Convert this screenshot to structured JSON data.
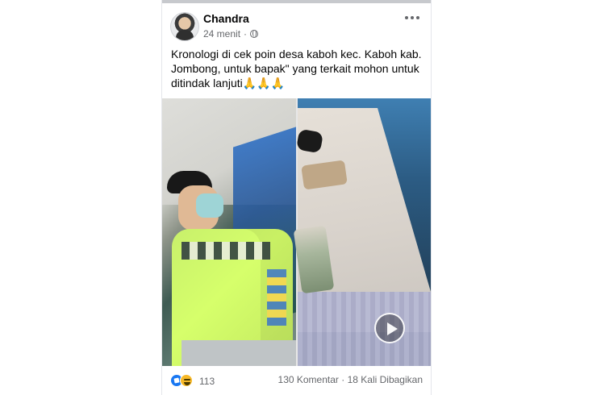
{
  "post": {
    "author": "Chandra",
    "time": "24 menit",
    "text": "Kronologi di cek poin desa kaboh kec. Kaboh kab. Jombong, untuk bapak\" yang terkait mohon untuk ditindak lanjuti🙏🙏🙏",
    "media": {
      "has_video": true
    },
    "reactions": {
      "count": "113"
    },
    "stats": {
      "comments": "130 Komentar",
      "shares": "18 Kali Dibagikan"
    }
  },
  "icons": {
    "privacy": "globe-icon",
    "more": "more-icon",
    "play": "play-icon",
    "like": "like-icon",
    "haha": "haha-icon"
  },
  "colors": {
    "facebook_blue": "#1877f2",
    "reaction_yellow": "#f7b928",
    "muted_text": "#65676b"
  }
}
